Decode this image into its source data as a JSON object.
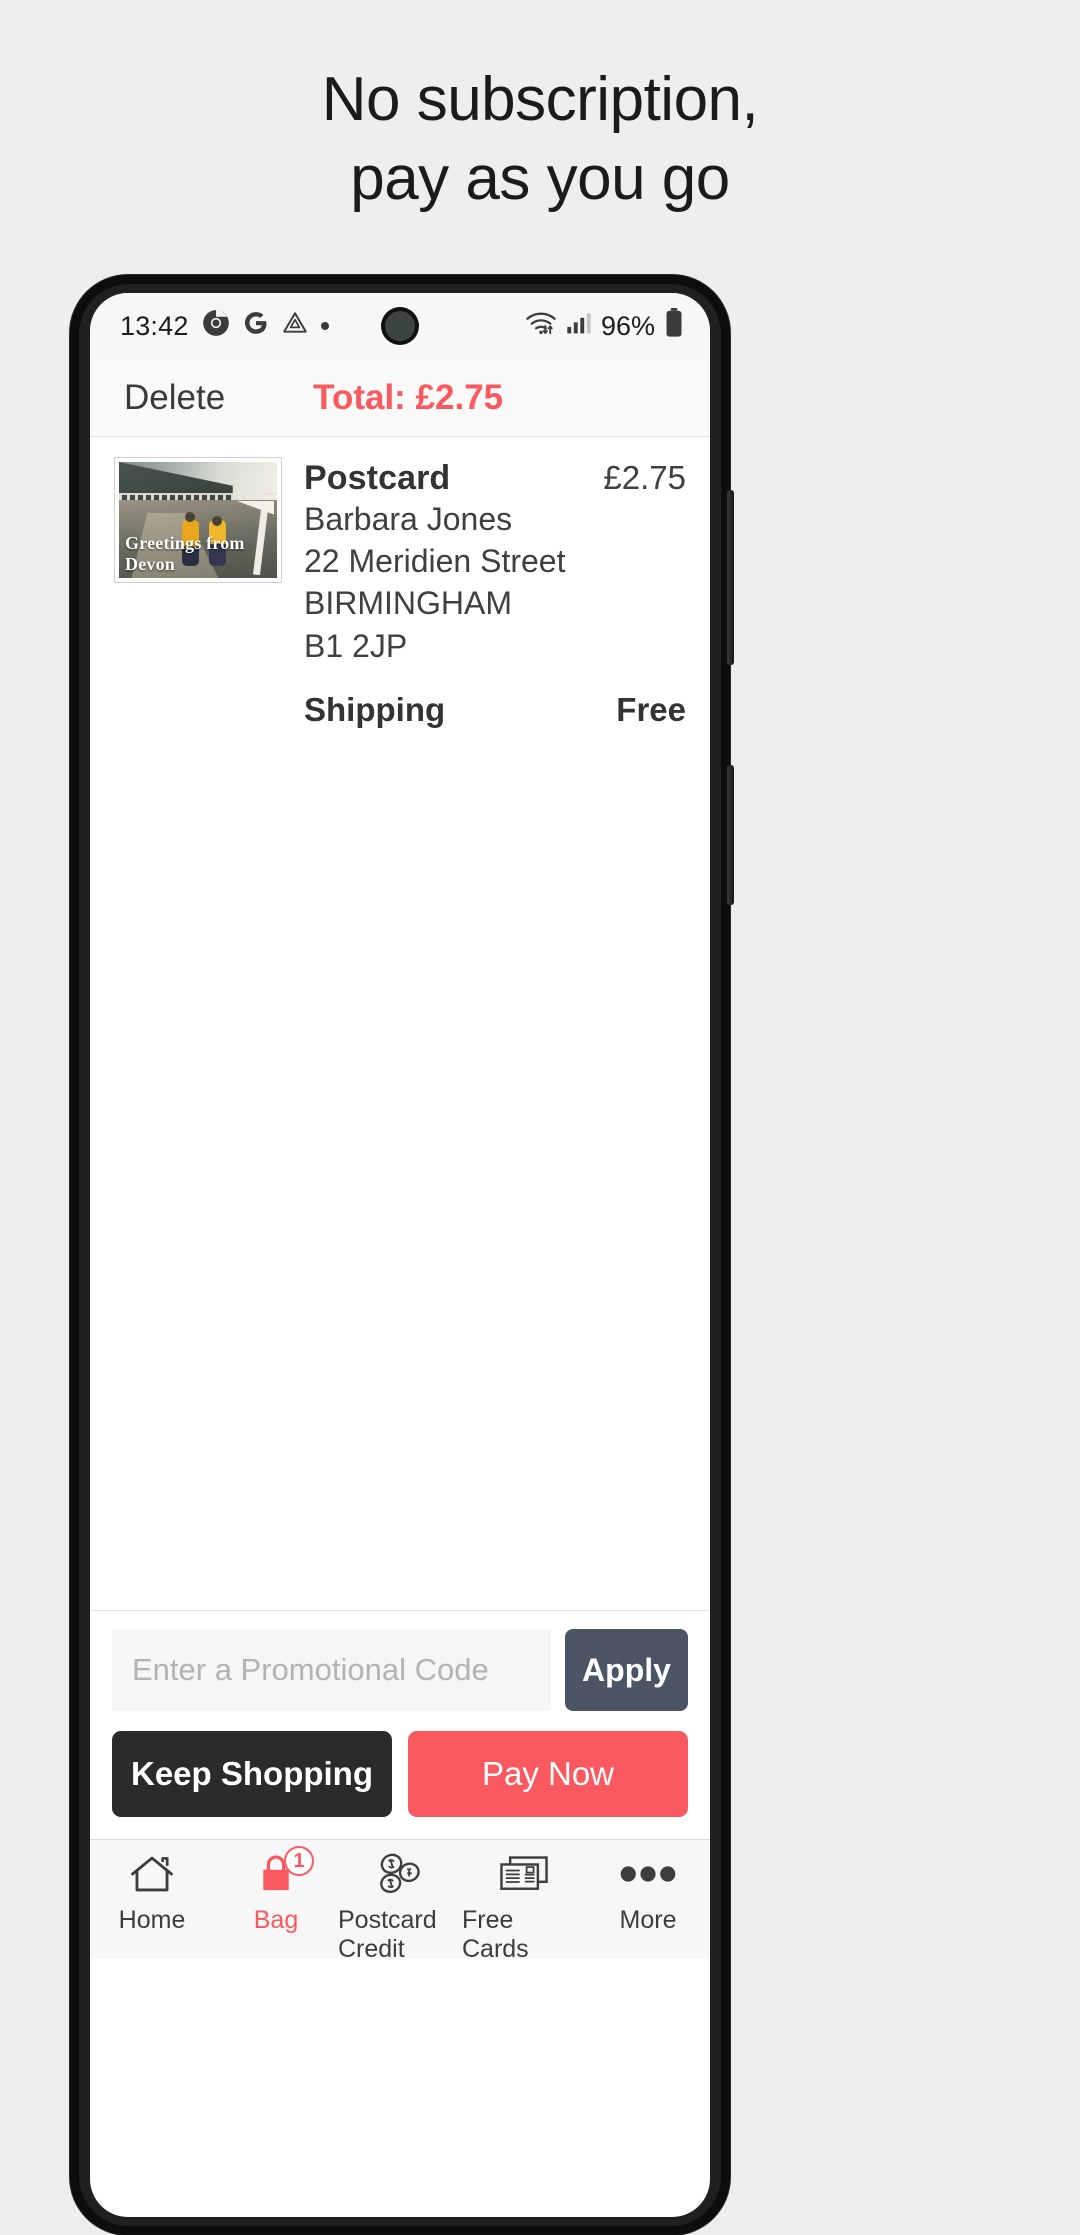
{
  "marketing": {
    "headline_line1": "No subscription,",
    "headline_line2": "pay as you go"
  },
  "status_bar": {
    "time": "13:42",
    "icons": [
      "chrome-icon",
      "google-icon",
      "drive-icon",
      "dot-icon"
    ],
    "wifi": "wifi-icon",
    "signal": "cellular-signal-icon",
    "battery_percent": "96%",
    "battery": "battery-icon"
  },
  "app_header": {
    "delete_label": "Delete",
    "total_label": "Total: £2.75",
    "total_color": "#f9595f"
  },
  "cart": {
    "item": {
      "thumbnail_caption": "Greetings from Devon",
      "title": "Postcard",
      "price": "£2.75",
      "recipient_name": "Barbara Jones",
      "address_line1": "22 Meridien Street",
      "address_city": "BIRMINGHAM",
      "address_postcode": "B1 2JP"
    },
    "shipping_label": "Shipping",
    "shipping_value": "Free"
  },
  "promo": {
    "placeholder": "Enter a Promotional Code",
    "value": "",
    "apply_label": "Apply",
    "apply_color": "#4b5565"
  },
  "actions": {
    "keep_shopping_label": "Keep Shopping",
    "keep_shopping_color": "#2b2b2b",
    "pay_now_label": "Pay Now",
    "pay_now_color": "#f9595f"
  },
  "bottom_nav": {
    "items": [
      {
        "label": "Home",
        "icon": "home-icon",
        "active": false
      },
      {
        "label": "Bag",
        "icon": "shopping-bag-icon",
        "active": true,
        "badge": "1"
      },
      {
        "label": "Postcard Credit",
        "icon": "coins-icon",
        "active": false
      },
      {
        "label": "Free Cards",
        "icon": "postcards-icon",
        "active": false
      },
      {
        "label": "More",
        "icon": "ellipsis-icon",
        "active": false
      }
    ]
  }
}
